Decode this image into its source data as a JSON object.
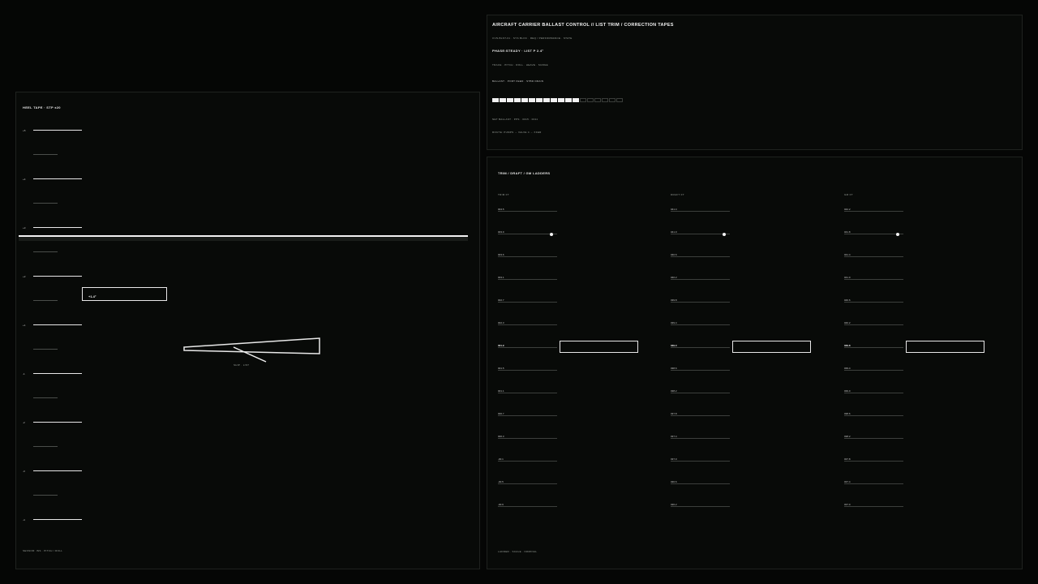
{
  "left_panel": {
    "title": "HEEL TAPE · STP ±20",
    "footer": "SENSOR: INS · PITCH / ROLL",
    "major_ticks": [
      "+5",
      "+4",
      "+3",
      "+2",
      "+1",
      "-1",
      "-2",
      "-3",
      "-4"
    ],
    "readout": "+1.4°",
    "ship_caption": "SHIP · LIST"
  },
  "top_panel": {
    "title": "AIRCRAFT CARRIER BALLAST CONTROL  //  LIST TRIM / CORRECTION TAPES",
    "subtitle": "CVN-BLST-01 · SYS BLOC · REQ / PERFORMANCE · STATE",
    "phase": "PHASE:STEADY · LIST P 2.4°",
    "trace": "TRACE · PITCH · ROLL · HEAVE · SURGE",
    "ballast_label": "BALLAST · PORT FEED · STBD DRAIN",
    "cells_total": 18,
    "cells_on": 12,
    "net": "NET BALLAST · PPS · 0015 · 0011",
    "route": "ROUTE: PUMPS → VALVE 4 → XFER"
  },
  "bottom_panel": {
    "title": "TRIM / DRAFT / GM LADDERS",
    "footer": "LADDER · SCALE · NOMINAL",
    "columns": [
      {
        "header": "TRIM FT",
        "rows": [
          "004.5",
          "003.9",
          "003.6",
          "003.1",
          "002.7",
          "002.3",
          "001.9",
          "001.5",
          "001.1",
          "000.7",
          "000.3",
          "-00.1",
          "-00.5",
          "-00.9"
        ],
        "dot_row": 1,
        "highlight_row": 6
      },
      {
        "header": "DRAFT FT",
        "rows": [
          "041.4",
          "041.0",
          "040.6",
          "040.2",
          "039.8",
          "039.4",
          "039.0",
          "038.6",
          "038.2",
          "037.8",
          "037.4",
          "037.0",
          "036.6",
          "036.2"
        ],
        "dot_row": 1,
        "highlight_row": 6
      },
      {
        "header": "GM FT",
        "rows": [
          "042.2",
          "041.8",
          "041.4",
          "041.0",
          "040.6",
          "040.2",
          "039.8",
          "039.4",
          "039.0",
          "038.6",
          "038.2",
          "037.8",
          "037.4",
          "037.0"
        ],
        "dot_row": 1,
        "highlight_row": 6
      }
    ]
  }
}
